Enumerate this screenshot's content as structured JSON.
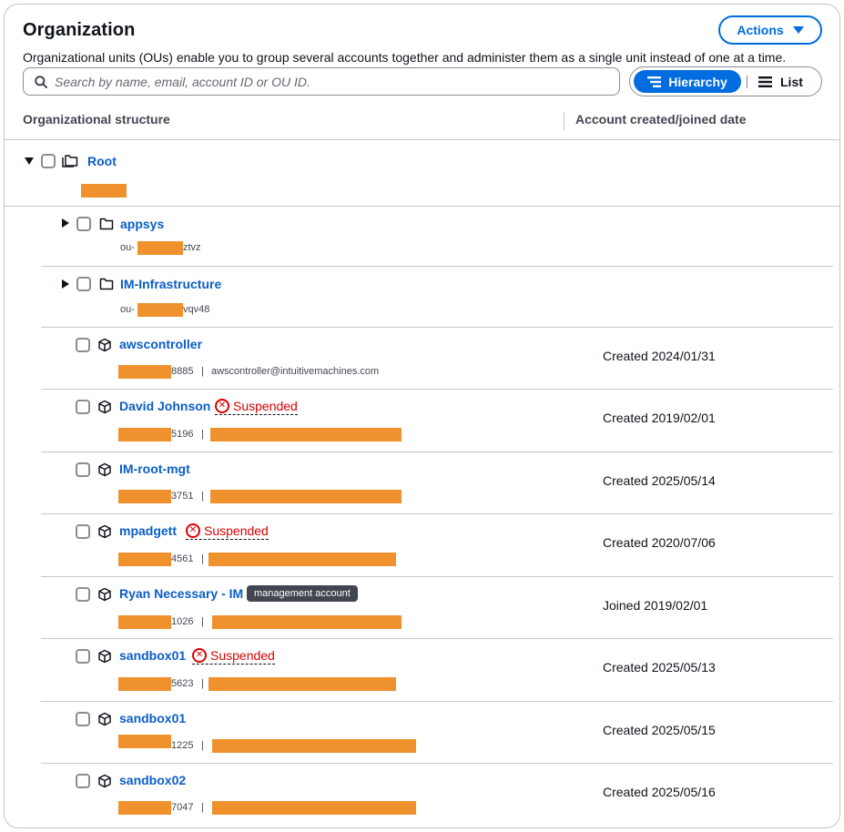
{
  "header": {
    "title": "Organization",
    "description": "Organizational units (OUs) enable you to group several accounts together and administer them as a single unit instead of one at a time.",
    "actions_label": "Actions",
    "search_placeholder": "Search by name, email, account ID or OU ID.",
    "view_toggle": {
      "selected": "Hierarchy",
      "hierarchy_label": "Hierarchy",
      "list_label": "List"
    }
  },
  "columns": {
    "structure": "Organizational structure",
    "date": "Account created/joined date"
  },
  "root": {
    "name": "Root"
  },
  "ous": [
    {
      "name": "appsys",
      "id_prefix": "ou-",
      "id_suffix": "ztvz"
    },
    {
      "name": "IM-Infrastructure",
      "id_prefix": "ou-",
      "id_suffix": "vqv48"
    }
  ],
  "accounts": [
    {
      "name": "awscontroller",
      "status": "",
      "badge": "",
      "id_suffix": "8885",
      "email": "awscontroller@intuitivemachines.com",
      "date": "Created 2024/01/31"
    },
    {
      "name": "David Johnson",
      "status": "Suspended",
      "badge": "",
      "id_suffix": "5196",
      "email": "",
      "date": "Created 2019/02/01"
    },
    {
      "name": "IM-root-mgt",
      "status": "",
      "badge": "",
      "id_suffix": "3751",
      "email": "",
      "date": "Created 2025/05/14"
    },
    {
      "name": "mpadgett",
      "status": "Suspended",
      "badge": "",
      "id_suffix": "4561",
      "email": "",
      "date": "Created 2020/07/06"
    },
    {
      "name": "Ryan Necessary - IM",
      "status": "",
      "badge": "management account",
      "id_suffix": "1026",
      "email": "",
      "date": "Joined 2019/02/01"
    },
    {
      "name": "sandbox01",
      "status": "Suspended",
      "badge": "",
      "id_suffix": "5623",
      "email": "",
      "date": "Created 2025/05/13"
    },
    {
      "name": "sandbox01",
      "status": "",
      "badge": "",
      "id_suffix": "1225",
      "email": "",
      "date": "Created 2025/05/15"
    },
    {
      "name": "sandbox02",
      "status": "",
      "badge": "",
      "id_suffix": "7047",
      "email": "",
      "date": "Created 2025/05/16"
    }
  ],
  "colors": {
    "link": "#0a5ec7",
    "primary": "#006ce0",
    "danger": "#db0000",
    "redaction": "#ef912d"
  },
  "icons": [
    "search-icon",
    "hierarchy-icon",
    "list-icon",
    "caret-down-icon",
    "folders-icon",
    "folder-icon",
    "account-cube-icon",
    "x-circle-icon"
  ]
}
